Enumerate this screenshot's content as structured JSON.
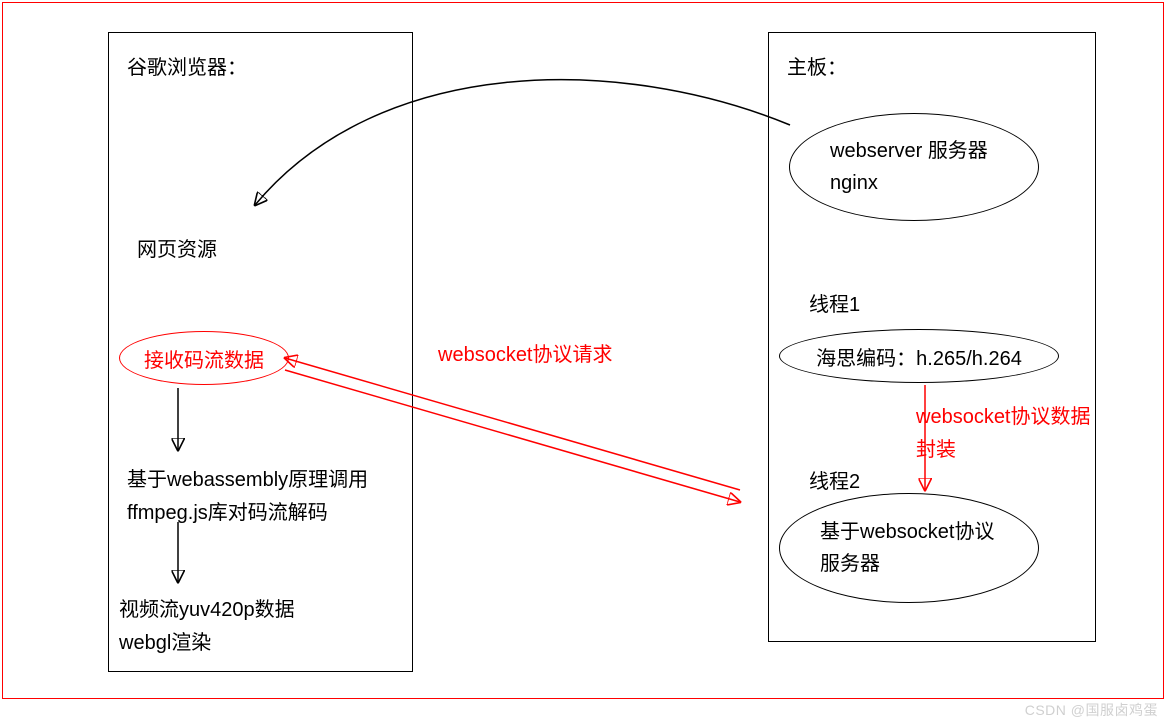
{
  "left": {
    "title": "谷歌浏览器：",
    "node_web_resource": "网页资源",
    "node_receive_stream": "接收码流数据",
    "node_ffmpeg_line1": "基于webassembly原理调用",
    "node_ffmpeg_line2": "ffmpeg.js库对码流解码",
    "node_yuv_line1": "视频流yuv420p数据",
    "node_yuv_line2": "webgl渲染"
  },
  "right": {
    "title": "主板：",
    "node_webserver_line1": "webserver 服务器",
    "node_webserver_line2": "nginx",
    "thread1_label": "线程1",
    "node_hisilicon": "海思编码：h.265/h.264",
    "thread2_label": "线程2",
    "node_ws_server_line1": "基于websocket协议",
    "node_ws_server_line2": "服务器"
  },
  "edges": {
    "ws_request": "websocket协议请求",
    "ws_data_line1": "websocket协议数据",
    "ws_data_line2": "封装"
  },
  "watermark": "CSDN @国服卤鸡蛋"
}
